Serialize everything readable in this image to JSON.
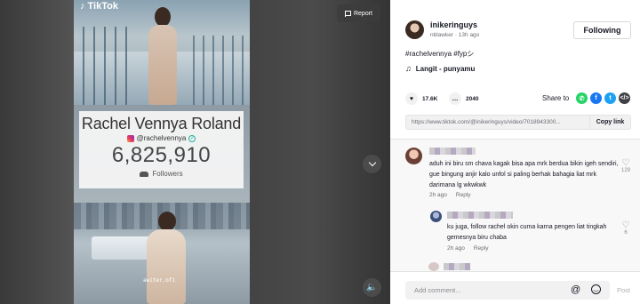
{
  "player": {
    "logo_text": "TikTok",
    "report_label": "Report",
    "watermark": "awiter.ofi"
  },
  "overlay_card": {
    "name": "Rachel Vennya Roland",
    "handle": "@rachelvennya",
    "count": "6,825,910",
    "followers_label": "Followers"
  },
  "author": {
    "username": "inikeringuys",
    "sub": "nblawker · 13h ago",
    "follow_label": "Following"
  },
  "caption": "#rachelvennya #fypシ",
  "music": "Langit - punyamu",
  "stats": {
    "likes": "17.6K",
    "comments": "2040"
  },
  "share": {
    "label": "Share to",
    "icons": [
      "whatsapp-icon",
      "facebook-icon",
      "twitter-icon",
      "embed-icon"
    ],
    "colors": {
      "whatsapp": "#25d366",
      "facebook": "#1877f2",
      "twitter": "#1da1f2",
      "embed": "#3f3f46"
    }
  },
  "link": {
    "url": "https://www.tiktok.com/@inikeringuys/video/7018943300...",
    "copy_label": "Copy link"
  },
  "comments": [
    {
      "text": "aduh ini biru sm chava kagak bisa apa mrk berdua bikin igeh sendiri, gue bingung anjir kalo unfol si paling berhak bahagia liat mrk darimana lg wkwkwk",
      "time": "2h ago",
      "reply_label": "Reply",
      "likes": "129"
    },
    {
      "text": "ku juga, follow rachel okin cuma karna pengen liat tingkah gemesnya biru chaba",
      "time": "2h ago",
      "reply_label": "Reply",
      "likes": "6"
    }
  ],
  "composer": {
    "placeholder": "Add comment...",
    "post_label": "Post"
  }
}
